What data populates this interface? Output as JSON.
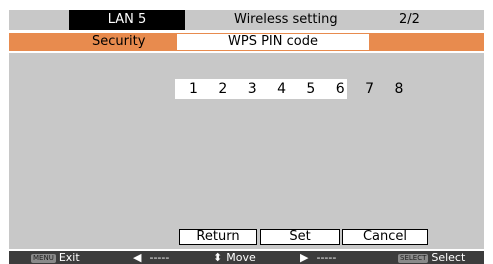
{
  "header": {
    "lan_label": "LAN 5",
    "title": "Wireless setting",
    "page": "2/2"
  },
  "sub_header": {
    "section_label": "Security",
    "field_value": "WPS PIN code"
  },
  "main": {
    "pin_code": "1 2 3 4 5 6 7 8"
  },
  "buttons": {
    "return": "Return",
    "set": "Set",
    "cancel": "Cancel"
  },
  "footer": {
    "menu_key": "MENU",
    "exit_label": "Exit",
    "left_arrow": "◀",
    "left_value": "-----",
    "updown_arrow": "⬍",
    "move_label": "Move",
    "right_arrow": "▶",
    "right_value": "-----",
    "select_key": "SELECT",
    "select_label": "Select"
  },
  "colors": {
    "accent_orange": "#e88b4e",
    "panel_gray": "#c8c8c8",
    "footer_dark": "#3c3c3c"
  }
}
